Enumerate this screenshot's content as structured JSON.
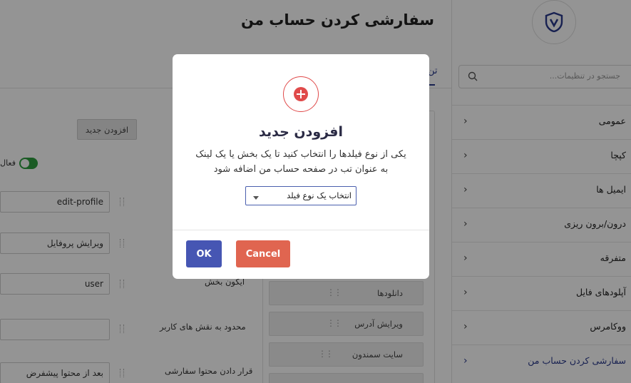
{
  "header": {
    "title": "سفارشی کردن حساب من"
  },
  "sidebar": {
    "search_placeholder": "جستجو در تنظیمات...",
    "items": [
      {
        "label": "عمومی"
      },
      {
        "label": "کپچا"
      },
      {
        "label": "ایمیل ها"
      },
      {
        "label": "درون/برون ریزی"
      },
      {
        "label": "متفرقه"
      },
      {
        "label": "آپلودهای فایل"
      },
      {
        "label": "ووکامرس"
      },
      {
        "label": "سفارشی کردن حساب من"
      }
    ]
  },
  "fields_list": {
    "items": [
      {
        "label": "دانلودها"
      },
      {
        "label": "ویرایش آدرس"
      },
      {
        "label": "سایت سمندون"
      }
    ]
  },
  "form": {
    "add_button": "افزودن جدید",
    "toggle_label": "فعال",
    "slug_value": "edit-profile",
    "title_value": "ویرایش پروفایل",
    "icon_label": "آیکون بخش",
    "icon_value": "user",
    "roles_label": "محدود به نقش های کاربر",
    "roles_value": "",
    "position_label": "قرار دادن محتوا سفارشی",
    "position_value": "بعد از محتوا پیشفرض"
  },
  "modal": {
    "title": "افزودن جدید",
    "text": "یکی از نوع فیلدها را انتخاب کنید تا یک بخش یا یک لینک به عنوان تب در صفحه حساب من اضافه شود",
    "select_value": "انتخاب یک نوع فیلد",
    "ok_label": "OK",
    "cancel_label": "Cancel",
    "icon": "plus-circle-icon"
  },
  "colors": {
    "primary": "#4656b3",
    "danger": "#e06550",
    "icon_red": "#e04a4a",
    "toggle_green": "#2e9e3e"
  }
}
